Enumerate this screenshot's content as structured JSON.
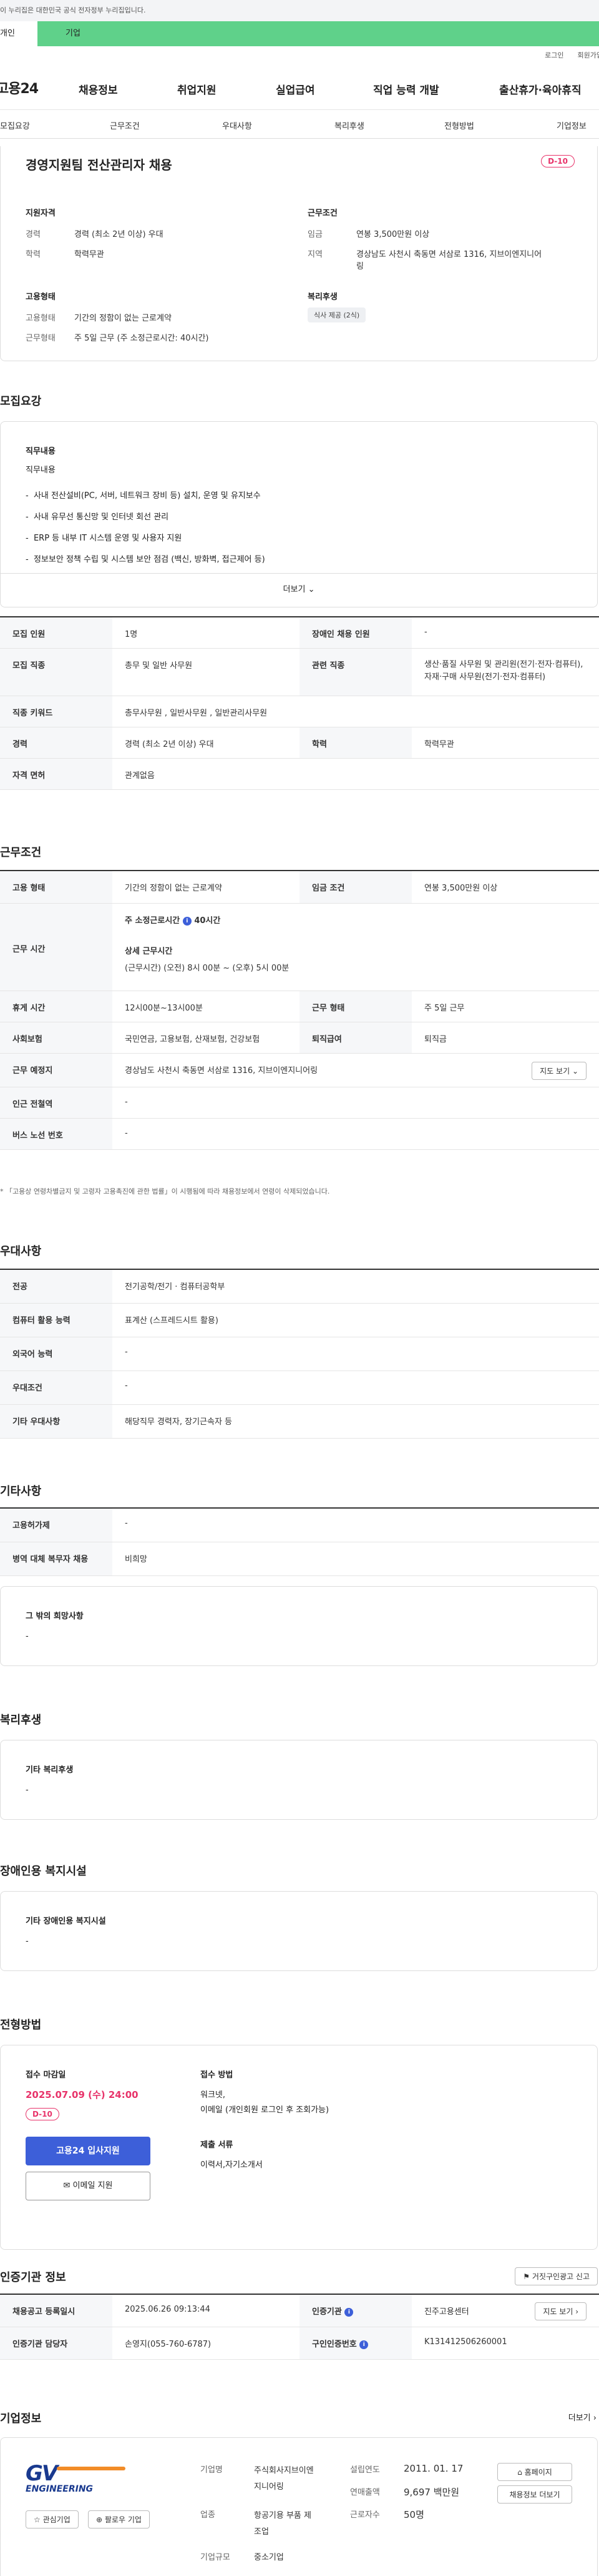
{
  "gov_banner": "이 누리집은 대한민국 공식 전자정부 누리집입니다.",
  "tabs": {
    "personal": "개인",
    "company": "기업"
  },
  "util": {
    "login": "로그인",
    "join": "회원가입"
  },
  "logo": "고용24",
  "gnb": [
    "채용정보",
    "취업지원",
    "실업급여",
    "직업 능력 개발",
    "출산휴가·육아휴직"
  ],
  "subnav": [
    "모집요강",
    "근무조건",
    "우대사항",
    "복리후생",
    "전형방법",
    "기업정보"
  ],
  "summary": {
    "title": "경영지원팀 전산관리자 채용",
    "dday": "D-10",
    "qual_h": "지원자격",
    "cond_h": "근무조건",
    "type_h": "고용형태",
    "welfare_h": "복리후생",
    "career_l": "경력",
    "career_v": "경력 (최소 2년 이상) 우대",
    "edu_l": "학력",
    "edu_v": "학력무관",
    "wage_l": "임금",
    "wage_v": "연봉 3,500만원 이상",
    "region_l": "지역",
    "region_v1": "경상남도 사천시 축동면 서삼로 1316, 지브이엔지니어",
    "region_v2": "링",
    "emp_l": "고용형태",
    "emp_v": "기간의 정함이 없는 근로계약",
    "work_l": "근무형태",
    "work_v": "주 5일 근무 (주 소정근로시간: 40시간)",
    "welfare_tag": "식사 제공 (2식)"
  },
  "recruit": {
    "title": "모집요강",
    "duty_h": "직무내용",
    "duty_sub": "직무내용",
    "duties": [
      "사내 전산설비(PC, 서버, 네트워크 장비 등) 설치, 운영 및 유지보수",
      "사내 유무선 통신망 및 인터넷 회선 관리",
      "ERP 등 내부 IT 시스템 운영 및 사용자 지원",
      "정보보안 정책 수립 및 시스템 보안 점검 (백신, 방화벽, 접근제어 등)"
    ],
    "more": "더보기",
    "rows": [
      {
        "k": "모집 인원",
        "v": "1명",
        "k2": "장애인 채용 인원",
        "v2": "-"
      },
      {
        "k": "모집 직종",
        "v": "총무 및 일반 사무원",
        "k2": "관련 직종",
        "v2": "생산·품질 사무원 및 관리원(전기·전자·컴퓨터), 자재·구매 사무원(전기·전자·컴퓨터)"
      },
      {
        "k": "직종 키워드",
        "v": "총무사무원 , 일반사무원 , 일반관리사무원"
      },
      {
        "k": "경력",
        "v": "경력 (최소 2년 이상) 우대",
        "k2": "학력",
        "v2": "학력무관"
      },
      {
        "k": "자격 면허",
        "v": "관계없음"
      }
    ]
  },
  "conditions": {
    "title": "근무조건",
    "emp_k": "고용 형태",
    "emp_v": "기간의 정함이 없는 근로계약",
    "wage_k": "임금 조건",
    "wage_v": "연봉 3,500만원 이상",
    "hours_k": "근무 시간",
    "hours_main": "주 소정근로시간",
    "hours_val": "40시간",
    "hours_detail_h": "상세 근무시간",
    "hours_detail": "(근무시간) (오전) 8시 00분 ~ (오후) 5시 00분",
    "break_k": "휴게 시간",
    "break_v": "12시00분~13시00분",
    "form_k": "근무 형태",
    "form_v": "주 5일 근무",
    "ins_k": "사회보험",
    "ins_v": "국민연금, 고용보험, 산재보험, 건강보험",
    "ret_k": "퇴직급여",
    "ret_v": "퇴직금",
    "place_k": "근무 예정지",
    "place_v": "경상남도 사천시 축동면 서삼로 1316, 지브이엔지니어링",
    "map_btn": "지도 보기",
    "station_k": "인근 전철역",
    "station_v": "-",
    "bus_k": "버스 노선 번호",
    "bus_v": "-",
    "note": "* 「고용상 연령차별금지 및 고령자 고용촉진에 관한 법률」이 시행됨에 따라 채용정보에서 연령이 삭제되었습니다."
  },
  "pref": {
    "title": "우대사항",
    "rows": [
      {
        "k": "전공",
        "v": "전기공학/전기 · 컴퓨터공학부"
      },
      {
        "k": "컴퓨터 활용 능력",
        "v": "표계산 (스프레드시트 활용)"
      },
      {
        "k": "외국어 능력",
        "v": "-"
      },
      {
        "k": "우대조건",
        "v": "-"
      },
      {
        "k": "기타 우대사항",
        "v": "해당직무 경력자, 장기근속자 등"
      }
    ]
  },
  "etc": {
    "title": "기타사항",
    "rows": [
      {
        "k": "고용허가제",
        "v": "-"
      },
      {
        "k": "병역 대체 복무자 채용",
        "v": "비희망"
      }
    ],
    "other_h": "그 밖의 희망사항",
    "other_v": "-"
  },
  "welfare": {
    "title": "복리후생",
    "box_h": "기타 복리후생",
    "box_v": "-"
  },
  "disab": {
    "title": "장애인용 복지시설",
    "box_h": "기타 장애인용 복지시설",
    "box_v": "-"
  },
  "screening": {
    "title": "전형방법",
    "deadline_h": "접수 마감일",
    "deadline_v": "2025.07.09 (수) 24:00",
    "dday": "D-10",
    "apply_btn": "고용24 입사지원",
    "email_btn": "이메일 지원",
    "method_h": "접수 방법",
    "method_v1": "워크넷,",
    "method_v2": "이메일 (개인회원 로그인 후 조회가능)",
    "docs_h": "제출 서류",
    "docs_v": "이력서,자기소개서"
  },
  "cert": {
    "title": "인증기관 정보",
    "report_btn": "거짓구인광고 신고",
    "reg_k": "채용공고 등록일시",
    "reg_v": "2025.06.26 09:13:44",
    "org_k": "인증기관",
    "org_v": "진주고용센터",
    "map_btn": "지도 보기",
    "mgr_k": "인증기관 담당자",
    "mgr_v": "손영지(055-760-6787)",
    "num_k": "구인인증번호",
    "num_v": "K131412506260001"
  },
  "company": {
    "title": "기업정보",
    "more": "더보기",
    "logo_main": "GV",
    "logo_sub": "ENGINEERING",
    "fav_btn": "관심기업",
    "follow_btn": "팔로우 기업",
    "home_btn": "홈페이지",
    "jobs_btn": "채용정보 더보기",
    "name_k": "기업명",
    "name_v1": "주식회사지브이엔",
    "name_v2": "지니어링",
    "ind_k": "업종",
    "ind_v1": "항공기용 부품 제",
    "ind_v2": "조업",
    "size_k": "기업규모",
    "size_v": "중소기업",
    "est_k": "설립연도",
    "est_v": "2011. 01. 17",
    "sales_k": "연매출액",
    "sales_v": "9,697 백만원",
    "emp_k": "근로자수",
    "emp_v": "50명"
  }
}
